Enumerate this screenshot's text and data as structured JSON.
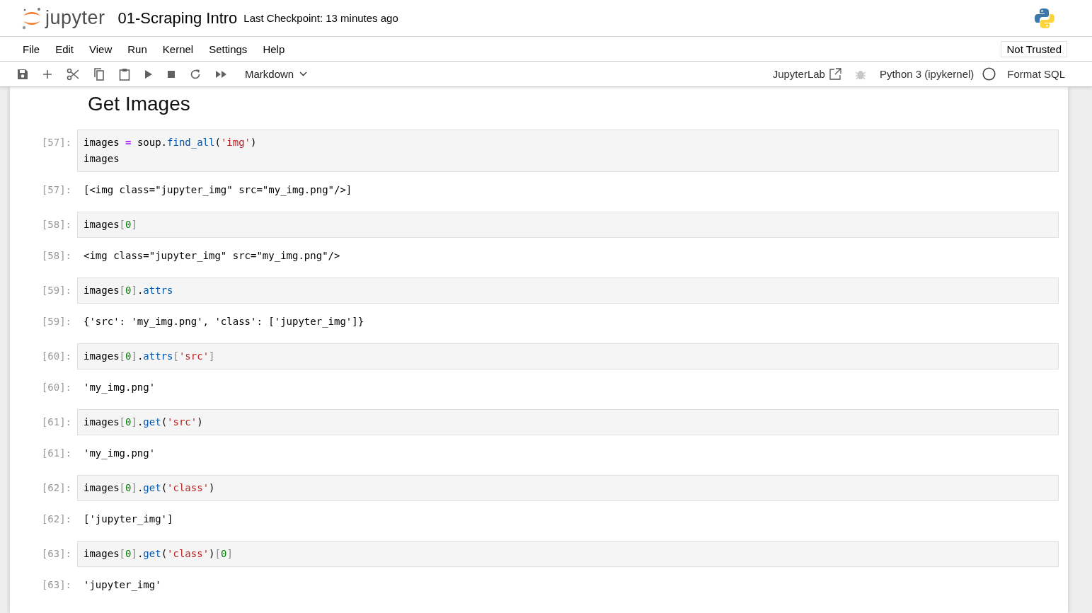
{
  "header": {
    "logo_text": "jupyter",
    "notebook_title": "01-Scraping Intro",
    "checkpoint": "Last Checkpoint: 13 minutes ago"
  },
  "menu": [
    "File",
    "Edit",
    "View",
    "Run",
    "Kernel",
    "Settings",
    "Help"
  ],
  "trust_badge": "Not Trusted",
  "toolbar": {
    "cell_type": "Markdown",
    "jupyterlab_link": "JupyterLab",
    "kernel": "Python 3 (ipykernel)",
    "kernel_busy": false,
    "format_button": "Format SQL"
  },
  "heading": "Get Images",
  "cells": [
    {
      "prompt": "[57]:",
      "input": [
        [
          {
            "text": "images ",
            "kind": "name"
          },
          {
            "text": "=",
            "kind": "operator"
          },
          {
            "text": " soup.",
            "kind": "name"
          },
          {
            "text": "find_all",
            "kind": "attribute"
          },
          {
            "text": "(",
            "kind": "name"
          },
          {
            "text": "'img'",
            "kind": "string"
          },
          {
            "text": ")",
            "kind": "name"
          }
        ],
        [
          {
            "text": "images",
            "kind": "name"
          }
        ]
      ],
      "out_prompt": "[57]:",
      "output": "[<img class=\"jupyter_img\" src=\"my_img.png\"/>]"
    },
    {
      "prompt": "[58]:",
      "input": [
        [
          {
            "text": "images",
            "kind": "name"
          },
          {
            "text": "[",
            "kind": "bracket"
          },
          {
            "text": "0",
            "kind": "number"
          },
          {
            "text": "]",
            "kind": "bracket"
          }
        ]
      ],
      "out_prompt": "[58]:",
      "output": "<img class=\"jupyter_img\" src=\"my_img.png\"/>"
    },
    {
      "prompt": "[59]:",
      "input": [
        [
          {
            "text": "images",
            "kind": "name"
          },
          {
            "text": "[",
            "kind": "bracket"
          },
          {
            "text": "0",
            "kind": "number"
          },
          {
            "text": "]",
            "kind": "bracket"
          },
          {
            "text": ".",
            "kind": "name"
          },
          {
            "text": "attrs",
            "kind": "attribute"
          }
        ]
      ],
      "out_prompt": "[59]:",
      "output": "{'src': 'my_img.png', 'class': ['jupyter_img']}"
    },
    {
      "prompt": "[60]:",
      "input": [
        [
          {
            "text": "images",
            "kind": "name"
          },
          {
            "text": "[",
            "kind": "bracket"
          },
          {
            "text": "0",
            "kind": "number"
          },
          {
            "text": "]",
            "kind": "bracket"
          },
          {
            "text": ".",
            "kind": "name"
          },
          {
            "text": "attrs",
            "kind": "attribute"
          },
          {
            "text": "[",
            "kind": "bracket"
          },
          {
            "text": "'src'",
            "kind": "string"
          },
          {
            "text": "]",
            "kind": "bracket"
          }
        ]
      ],
      "out_prompt": "[60]:",
      "output": "'my_img.png'"
    },
    {
      "prompt": "[61]:",
      "input": [
        [
          {
            "text": "images",
            "kind": "name"
          },
          {
            "text": "[",
            "kind": "bracket"
          },
          {
            "text": "0",
            "kind": "number"
          },
          {
            "text": "]",
            "kind": "bracket"
          },
          {
            "text": ".",
            "kind": "name"
          },
          {
            "text": "get",
            "kind": "attribute"
          },
          {
            "text": "(",
            "kind": "name"
          },
          {
            "text": "'src'",
            "kind": "string"
          },
          {
            "text": ")",
            "kind": "name"
          }
        ]
      ],
      "out_prompt": "[61]:",
      "output": "'my_img.png'"
    },
    {
      "prompt": "[62]:",
      "input": [
        [
          {
            "text": "images",
            "kind": "name"
          },
          {
            "text": "[",
            "kind": "bracket"
          },
          {
            "text": "0",
            "kind": "number"
          },
          {
            "text": "]",
            "kind": "bracket"
          },
          {
            "text": ".",
            "kind": "name"
          },
          {
            "text": "get",
            "kind": "attribute"
          },
          {
            "text": "(",
            "kind": "name"
          },
          {
            "text": "'class'",
            "kind": "string"
          },
          {
            "text": ")",
            "kind": "name"
          }
        ]
      ],
      "out_prompt": "[62]:",
      "output": "['jupyter_img']"
    },
    {
      "prompt": "[63]:",
      "input": [
        [
          {
            "text": "images",
            "kind": "name"
          },
          {
            "text": "[",
            "kind": "bracket"
          },
          {
            "text": "0",
            "kind": "number"
          },
          {
            "text": "]",
            "kind": "bracket"
          },
          {
            "text": ".",
            "kind": "name"
          },
          {
            "text": "get",
            "kind": "attribute"
          },
          {
            "text": "(",
            "kind": "name"
          },
          {
            "text": "'class'",
            "kind": "string"
          },
          {
            "text": ")",
            "kind": "name"
          },
          {
            "text": "[",
            "kind": "bracket"
          },
          {
            "text": "0",
            "kind": "number"
          },
          {
            "text": "]",
            "kind": "bracket"
          }
        ]
      ],
      "out_prompt": "[63]:",
      "output": "'jupyter_img'"
    }
  ]
}
